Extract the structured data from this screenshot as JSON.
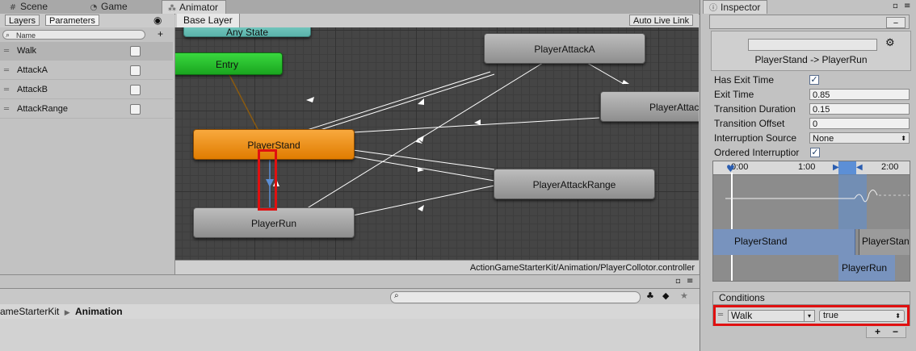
{
  "tabs": {
    "scene": {
      "label": "Scene",
      "icon": "grid-icon"
    },
    "game": {
      "label": "Game",
      "icon": "pacman-icon"
    },
    "animator": {
      "label": "Animator",
      "icon": "animator-icon"
    },
    "inspector": {
      "label": "Inspector",
      "icon": "info-icon"
    }
  },
  "left_panel": {
    "subtabs": [
      "Layers",
      "Parameters"
    ],
    "search_placeholder": "Name",
    "parameters": [
      {
        "name": "Walk"
      },
      {
        "name": "AttackA"
      },
      {
        "name": "AttackB"
      },
      {
        "name": "AttackRange"
      }
    ]
  },
  "animator": {
    "layer": "Base Layer",
    "auto_live_link": "Auto Live Link",
    "states": {
      "any_state": "Any State",
      "entry": "Entry",
      "player_stand": "PlayerStand",
      "player_run": "PlayerRun",
      "player_attack_a": "PlayerAttackA",
      "player_attack_b": "PlayerAttac",
      "player_attack_range": "PlayerAttackRange"
    },
    "controller_path": "ActionGameStarterKit/Animation/PlayerCollotor.controller"
  },
  "project": {
    "breadcrumb": [
      "ameStarterKit",
      "Animation"
    ]
  },
  "inspector": {
    "transition_title": "PlayerStand -> PlayerRun",
    "fields": {
      "has_exit_time": {
        "label": "Has Exit Time",
        "checked": true
      },
      "exit_time": {
        "label": "Exit Time",
        "value": "0.85"
      },
      "transition_duration": {
        "label": "Transition Duration",
        "value": "0.15"
      },
      "transition_offset": {
        "label": "Transition Offset",
        "value": "0"
      },
      "interruption_source": {
        "label": "Interruption Source",
        "value": "None"
      },
      "ordered_interruption": {
        "label": "Ordered Interruptior",
        "checked": true
      }
    },
    "timeline": {
      "ticks": [
        "0:00",
        "1:00",
        "2:00"
      ],
      "from_state": "PlayerStand",
      "from_state_repeat": "PlayerStan",
      "to_state": "PlayerRun"
    },
    "conditions": {
      "header": "Conditions",
      "items": [
        {
          "parameter": "Walk",
          "value": "true"
        }
      ],
      "add": "+",
      "remove": "−"
    }
  },
  "colors": {
    "state_orange": "#e88a10",
    "state_green": "#22b828",
    "state_teal": "#6cc4bb",
    "selection_red": "#e01010",
    "transition_blue": "#5c8fd6"
  }
}
